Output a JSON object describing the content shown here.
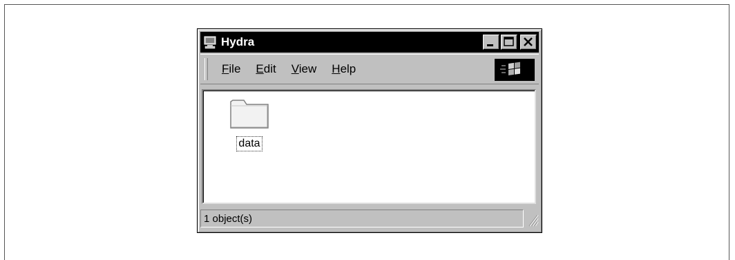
{
  "window": {
    "title": "Hydra",
    "title_icon": "computer-icon"
  },
  "menu": {
    "items": [
      {
        "label_first": "F",
        "label_rest": "ile"
      },
      {
        "label_first": "E",
        "label_rest": "dit"
      },
      {
        "label_first": "V",
        "label_rest": "iew"
      },
      {
        "label_first": "H",
        "label_rest": "elp"
      }
    ],
    "logo": "windows-logo-icon"
  },
  "content": {
    "items": [
      {
        "name": "data",
        "icon": "folder-icon"
      }
    ]
  },
  "status": {
    "text": "1 object(s)"
  },
  "colors": {
    "titlebar": "#000000",
    "chrome": "#c0c0c0",
    "content_bg": "#ffffff"
  }
}
